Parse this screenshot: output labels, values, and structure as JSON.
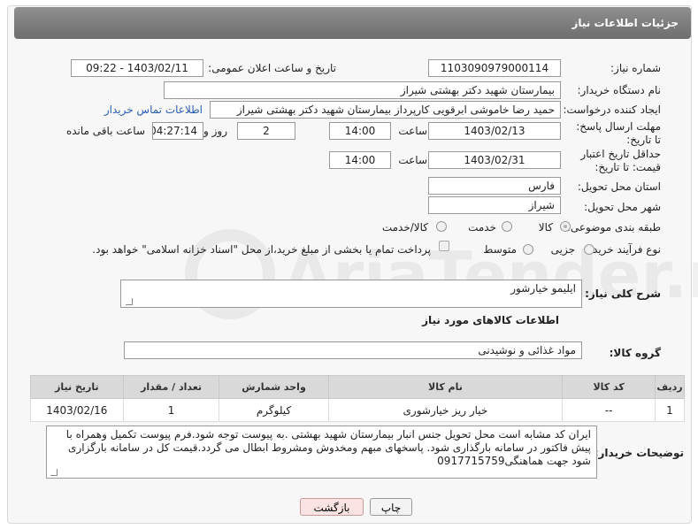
{
  "header": {
    "title": "جزئیات اطلاعات نیاز"
  },
  "fields": {
    "need_number_label": "شماره نیاز:",
    "need_number": "1103090979000114",
    "announce_label": "تاریخ و ساعت اعلان عمومی:",
    "announce_value": "1403/02/11 - 09:22",
    "buyer_org_label": "نام دستگاه خریدار:",
    "buyer_org": "بیمارستان شهید دکتر بهشتی شیراز",
    "creator_label": "ایجاد کننده درخواست:",
    "creator": "حمید رضا خاموشی ابرقویی کارپرداز بیمارستان شهید دکتر بهشتی شیراز",
    "contact_link": "اطلاعات تماس خریدار",
    "reply_deadline_label": "مهلت ارسال پاسخ: تا تاریخ:",
    "reply_date": "1403/02/13",
    "time_label": "ساعت",
    "reply_time": "14:00",
    "days_value": "2",
    "days_label": "روز و",
    "remaining_value": "04:27:14",
    "remaining_label": "ساعت باقی مانده",
    "validity_label": "حداقل تاریخ اعتبار قیمت: تا تاریخ:",
    "validity_date": "1403/02/31",
    "validity_time_label": "ساعت",
    "validity_time": "14:00",
    "province_label": "استان محل تحویل:",
    "province": "فارس",
    "city_label": "شهر محل تحویل:",
    "city": "شیراز",
    "category_label": "طبقه بندی موضوعی:",
    "category_options": [
      "کالا",
      "خدمت",
      "کالا/خدمت"
    ],
    "process_label": "نوع فرآیند خرید :",
    "process_options": [
      "جزیی",
      "متوسط"
    ],
    "payment_note": "پرداخت تمام یا بخشی از مبلغ خرید،از محل \"اسناد خزانه اسلامی\" خواهد بود."
  },
  "summary": {
    "label": "شرح کلی نیاز:",
    "value": "ایلیمو خیارشور"
  },
  "goods_info_title": "اطلاعات کالاهای مورد نیاز",
  "goods_group": {
    "label": "گروه کالا:",
    "value": "مواد غذائی و نوشیدنی"
  },
  "table": {
    "headers": [
      "ردیف",
      "کد کالا",
      "نام کالا",
      "واحد شمارش",
      "تعداد / مقدار",
      "تاریخ نیاز"
    ],
    "rows": [
      [
        "1",
        "--",
        "خیار ریز خیارشوری",
        "کیلوگرم",
        "1",
        "1403/02/16"
      ]
    ]
  },
  "buyer_notes": {
    "label": "توضیحات خریدار:",
    "value": "ایران کد مشابه است محل تحویل جنس انبار بیمارستان شهید بهشتی .به پیوست توجه شود.فرم پیوست تکمیل وهمراه با پیش فاکتور در سامانه بارگذاری شود. پاسخهای مبهم ومخدوش ومشروط ابطال می گردد.قیمت کل در سامانه بارگزاری شود جهت هماهنگی09177157​59"
  },
  "buttons": {
    "print": "چاپ",
    "back": "بازگشت"
  },
  "watermark": "AriaTender.net",
  "colors": {
    "header": "#7d7d7d",
    "link": "#2a5db0",
    "back_button": "#fbe3e3"
  }
}
